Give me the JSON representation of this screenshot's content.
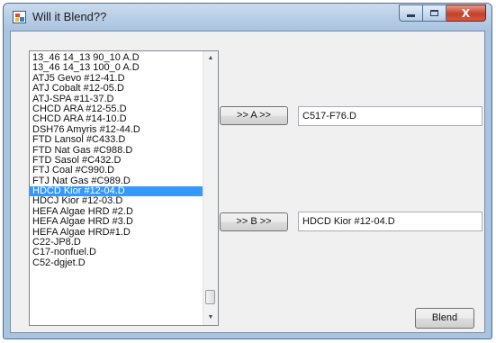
{
  "window": {
    "title": "Will it Blend??"
  },
  "caption_buttons": {
    "close_symbol": "X"
  },
  "list": {
    "items": [
      "13_46 14_13 90_10 A.D",
      "13_46 14_13 100_0 A.D",
      "ATJ5 Gevo #12-41.D",
      "ATJ Cobalt #12-05.D",
      "ATJ-SPA #11-37.D",
      "CHCD ARA #12-55.D",
      "CHCD ARA #14-10.D",
      "DSH76 Amyris #12-44.D",
      "FTD Lansol #C433.D",
      "FTD Nat Gas #C988.D",
      "FTD Sasol #C432.D",
      "FTJ Coal #C990.D",
      "FTJ Nat Gas #C989.D",
      "HDCD Kior #12-04.D",
      "HDCJ Kior #12-03.D",
      "HEFA Algae HRD #2.D",
      "HEFA Algae HRD #3.D",
      "HEFA Algae HRD#1.D",
      "C22-JP8.D",
      "C17-nonfuel.D",
      "C52-dgjet.D"
    ],
    "selected_index": 13
  },
  "buttons": {
    "a_label": ">> A >>",
    "b_label": ">> B >>",
    "blend_label": "Blend"
  },
  "fields": {
    "a_value": "C517-F76.D",
    "b_value": "HDCD Kior #12-04.D"
  }
}
